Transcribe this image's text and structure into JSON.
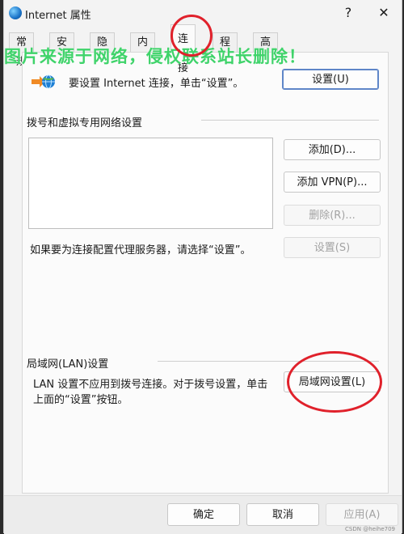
{
  "window": {
    "title": "Internet 属性",
    "help_symbol": "?",
    "close_symbol": "✕"
  },
  "tabs": [
    "常规",
    "安全",
    "隐私",
    "内容",
    "连接",
    "程序",
    "高级"
  ],
  "active_tab": "连接",
  "watermark": "图片来源于网络，侵权联系站长删除！",
  "setup": {
    "text": "要设置 Internet 连接，单击“设置”。",
    "button": "设置(U)"
  },
  "dialup": {
    "title": "拨号和虚拟专用网络设置",
    "add": "添加(D)...",
    "add_vpn": "添加 VPN(P)...",
    "remove": "删除(R)...",
    "proxy_text": "如果要为连接配置代理服务器，请选择“设置”。",
    "settings": "设置(S)"
  },
  "lan": {
    "title": "局域网(LAN)设置",
    "line1": "LAN 设置不应用到拨号连接。对于拨号设置，单击",
    "line2": "上面的“设置”按钮。",
    "button": "局域网设置(L)"
  },
  "footer": {
    "ok": "确定",
    "cancel": "取消",
    "apply": "应用(A)"
  },
  "credit": "CSDN @heihe709",
  "colors": {
    "annotation": "#e0212b",
    "watermark": "#3fd36a"
  },
  "icons": {
    "window": "globe-icon",
    "setup": "network-globe-icon"
  }
}
